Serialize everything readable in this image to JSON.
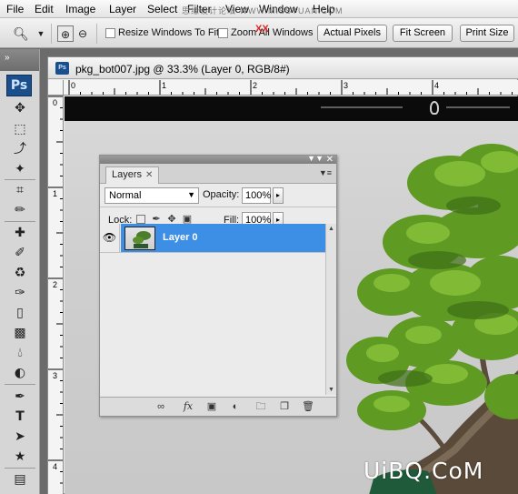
{
  "menu": [
    "File",
    "Edit",
    "Image",
    "Layer",
    "Select",
    "Filter",
    "View",
    "Window",
    "Help"
  ],
  "watermark_top": "思缘设计论坛  WWW.MISSYUAN.COM",
  "watermark_xx": "XX",
  "options": {
    "resize_label": "Resize Windows To Fit",
    "zoom_all_label": "Zoom All Windows",
    "actual_pixels": "Actual Pixels",
    "fit_screen": "Fit Screen",
    "print_size": "Print Size"
  },
  "tools": {
    "ps_logo": "Ps",
    "collapse": "»"
  },
  "document": {
    "title": "pkg_bot007.jpg @ 33.3% (Layer 0, RGB/8#)",
    "ruler_h": [
      "0",
      "1",
      "2",
      "3",
      "4"
    ],
    "ruler_v": [
      "0",
      "1",
      "2",
      "3",
      "4"
    ]
  },
  "layers_panel": {
    "tab": "Layers",
    "blend_mode": "Normal",
    "opacity_label": "Opacity:",
    "opacity_value": "100%",
    "lock_label": "Lock:",
    "fill_label": "Fill:",
    "fill_value": "100%",
    "layer_name": "Layer 0"
  },
  "watermark": "UiBQ.CoM"
}
